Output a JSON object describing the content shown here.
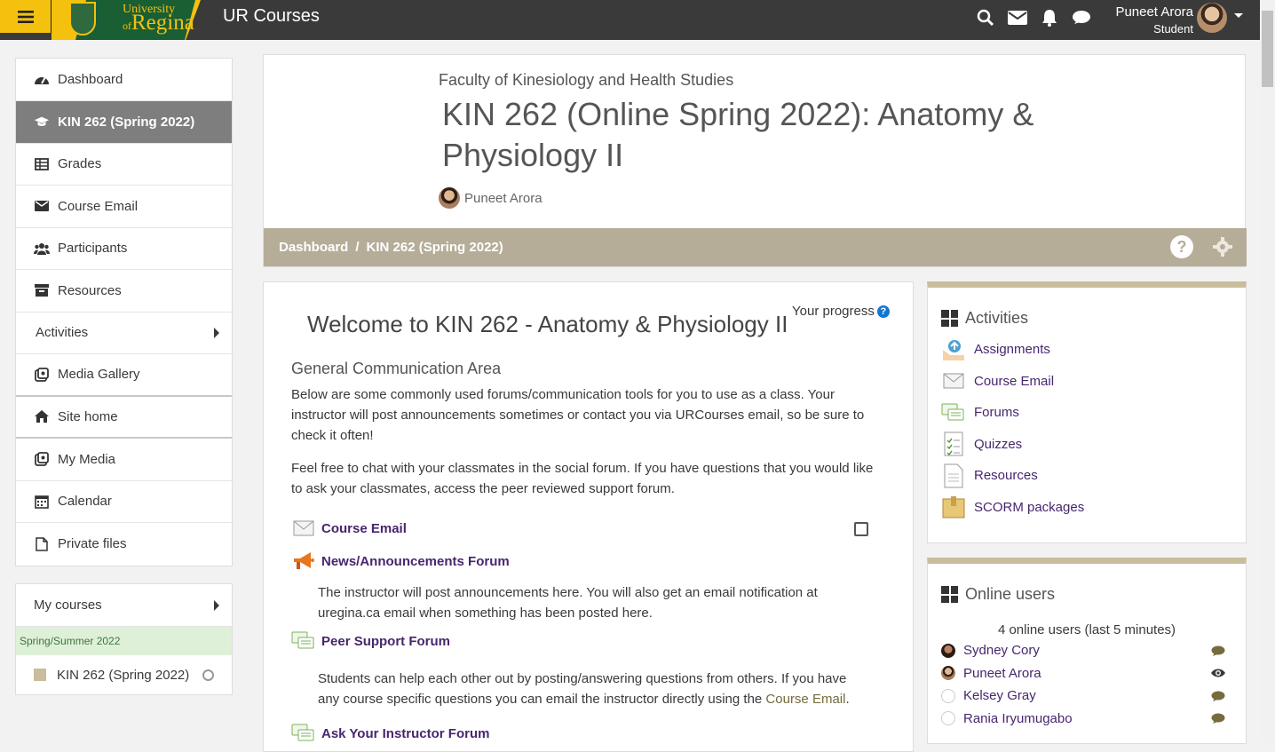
{
  "topbar": {
    "site_name": "UR Courses",
    "logo_line1": "University",
    "logo_line2_prefix": "of",
    "logo_line2": "Regina",
    "user_name": "Puneet Arora",
    "user_role": "Student",
    "icons": [
      "search-icon",
      "envelope-icon",
      "bell-icon",
      "chat-icon"
    ]
  },
  "sidebar": {
    "items": [
      {
        "label": "Dashboard",
        "icon": "dashboard-icon"
      },
      {
        "label": "KIN 262 (Spring 2022)",
        "icon": "graduation-cap-icon"
      },
      {
        "label": "Grades",
        "icon": "table-icon"
      },
      {
        "label": "Course Email",
        "icon": "envelope-icon"
      },
      {
        "label": "Participants",
        "icon": "users-icon"
      },
      {
        "label": "Resources",
        "icon": "archive-icon"
      },
      {
        "label": "Activities",
        "icon": ""
      },
      {
        "label": "Media Gallery",
        "icon": "media-icon"
      },
      {
        "label": "Site home",
        "icon": "home-icon"
      },
      {
        "label": "My Media",
        "icon": "media-icon"
      },
      {
        "label": "Calendar",
        "icon": "calendar-icon"
      },
      {
        "label": "Private files",
        "icon": "file-icon"
      }
    ],
    "my_courses": "My courses",
    "term": "Spring/Summer 2022",
    "course": "KIN 262 (Spring 2022)"
  },
  "header": {
    "faculty": "Faculty of Kinesiology and Health Studies",
    "title": "KIN 262 (Online Spring 2022): Anatomy & Physiology II",
    "teacher": "Puneet Arora",
    "breadcrumb": [
      "Dashboard",
      "KIN 262 (Spring 2022)"
    ],
    "separator": "/",
    "help": "?"
  },
  "main": {
    "welcome": "Welcome to KIN 262 - Anatomy & Physiology II",
    "progress_label": "Your progress",
    "progress_q": "?",
    "section_title": "General Communication Area",
    "para1": "Below are some commonly used forums/communication tools for you to use as a class.  Your instructor will post announcements sometimes or contact you via URCourses email, so be sure to check it often!",
    "para2": "Feel free to chat with your classmates in the social forum.  If you have questions that you would like to ask your classmates, access the peer reviewed support forum.",
    "activities": [
      {
        "label": "Course Email",
        "icon": "envelope-icon"
      },
      {
        "label": "News/Announcements Forum",
        "icon": "megaphone-icon"
      },
      {
        "label": "Peer Support Forum",
        "icon": "forum-icon"
      },
      {
        "label": "Ask Your Instructor Forum",
        "icon": "forum-icon"
      }
    ],
    "news_desc": "The instructor will post announcements here. You will also get an email notification at uregina.ca email when something has been posted here.",
    "peer_desc_1": "Students can help each other out by posting/answering questions from others. If you have any course specific questions you can email the instructor directly using the ",
    "peer_desc_link": "Course Email",
    "peer_desc_2": "."
  },
  "activities_block": {
    "title": "Activities",
    "items": [
      {
        "label": "Assignments",
        "icon": "assignment-icon"
      },
      {
        "label": "Course Email",
        "icon": "envelope-icon"
      },
      {
        "label": "Forums",
        "icon": "forum-icon"
      },
      {
        "label": "Quizzes",
        "icon": "quiz-icon"
      },
      {
        "label": "Resources",
        "icon": "file-icon"
      },
      {
        "label": "SCORM packages",
        "icon": "scorm-icon"
      }
    ]
  },
  "online_block": {
    "title": "Online users",
    "count": "4 online users (last 5 minutes)",
    "users": [
      {
        "name": "Sydney Cory",
        "action": "message-icon"
      },
      {
        "name": "Puneet Arora",
        "action": "eye-icon"
      },
      {
        "name": "Kelsey Gray",
        "action": "message-icon"
      },
      {
        "name": "Rania Iryumugabo",
        "action": "message-icon"
      }
    ]
  },
  "colors": {
    "brand_yellow": "#f4c10f",
    "brand_green": "#1a5e34",
    "link_purple": "#47266e",
    "crumb_bg": "#b5ad98",
    "topbar": "#3a3a3a"
  }
}
